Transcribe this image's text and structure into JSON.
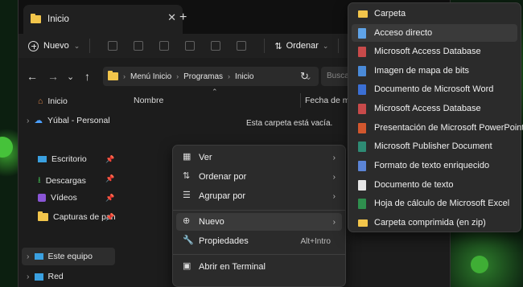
{
  "window": {
    "tab_title": "Inicio",
    "close_glyph": "✕",
    "new_tab_glyph": "+"
  },
  "toolbar": {
    "new_label": "Nuevo",
    "sort_label": "Ordenar",
    "more_glyph": "≡"
  },
  "address": {
    "breadcrumb": [
      "Menú Inicio",
      "Programas",
      "Inicio"
    ],
    "search_placeholder": "Buscar"
  },
  "sidebar": {
    "items": [
      {
        "label": "Inicio",
        "icon": "home-icon"
      },
      {
        "label": "Yúbal - Personal",
        "icon": "cloud-icon"
      },
      {
        "label": "Escritorio",
        "icon": "desktop-icon",
        "pinned": true
      },
      {
        "label": "Descargas",
        "icon": "download-icon",
        "pinned": true
      },
      {
        "label": "Vídeos",
        "icon": "video-icon",
        "pinned": true
      },
      {
        "label": "Capturas de pan",
        "icon": "folder-icon",
        "pinned": true
      },
      {
        "label": "Este equipo",
        "icon": "pc-icon"
      },
      {
        "label": "Red",
        "icon": "network-icon"
      }
    ]
  },
  "content": {
    "col_name": "Nombre",
    "col_date": "Fecha de mo",
    "empty_text": "Esta carpeta está vacía."
  },
  "context_menu": {
    "items": [
      {
        "label": "Ver",
        "icon": "grid-icon",
        "submenu": true
      },
      {
        "label": "Ordenar por",
        "icon": "sort-icon",
        "submenu": true
      },
      {
        "label": "Agrupar por",
        "icon": "group-icon",
        "submenu": true
      },
      {
        "label": "Nuevo",
        "icon": "new-icon",
        "submenu": true
      },
      {
        "label": "Propiedades",
        "icon": "wrench-icon",
        "shortcut": "Alt+Intro"
      },
      {
        "label": "Abrir en Terminal",
        "icon": "terminal-icon"
      }
    ]
  },
  "new_submenu": {
    "items": [
      {
        "label": "Carpeta",
        "icon": "folder-icon",
        "color": "#f2c54b"
      },
      {
        "label": "Acceso directo",
        "icon": "shortcut-icon",
        "color": "#5fa3e8"
      },
      {
        "label": "Microsoft Access Database",
        "icon": "access-icon",
        "color": "#c84a4a"
      },
      {
        "label": "Imagen de mapa de bits",
        "icon": "bitmap-icon",
        "color": "#4a8ad8"
      },
      {
        "label": "Documento de Microsoft Word",
        "icon": "word-icon",
        "color": "#3b6fd4"
      },
      {
        "label": "Microsoft Access Database",
        "icon": "access-icon",
        "color": "#c84a4a"
      },
      {
        "label": "Presentación de Microsoft PowerPoint",
        "icon": "powerpoint-icon",
        "color": "#d2572e"
      },
      {
        "label": "Microsoft Publisher Document",
        "icon": "publisher-icon",
        "color": "#2e8b74"
      },
      {
        "label": "Formato de texto enriquecido",
        "icon": "rtf-icon",
        "color": "#5b84d6"
      },
      {
        "label": "Documento de texto",
        "icon": "text-icon",
        "color": "#e6e6e6"
      },
      {
        "label": "Hoja de cálculo de Microsoft Excel",
        "icon": "excel-icon",
        "color": "#2f8f4e"
      },
      {
        "label": "Carpeta comprimida (en zip)",
        "icon": "zip-folder-icon",
        "color": "#f2c54b"
      }
    ]
  }
}
